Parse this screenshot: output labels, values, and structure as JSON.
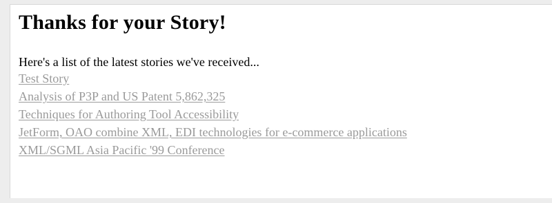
{
  "page": {
    "title": "Thanks for your Story!",
    "intro": "Here's a list of the latest stories we've received...",
    "stories": [
      "Test Story",
      "Analysis of P3P and US Patent 5,862,325",
      "Techniques for Authoring Tool Accessibility",
      "JetForm, OAO combine XML, EDI technologies for e-commerce applications",
      "XML/SGML Asia Pacific '99 Conference"
    ]
  },
  "colors": {
    "background": "#ffffff",
    "link": "#9a9a9a",
    "text": "#000000"
  }
}
